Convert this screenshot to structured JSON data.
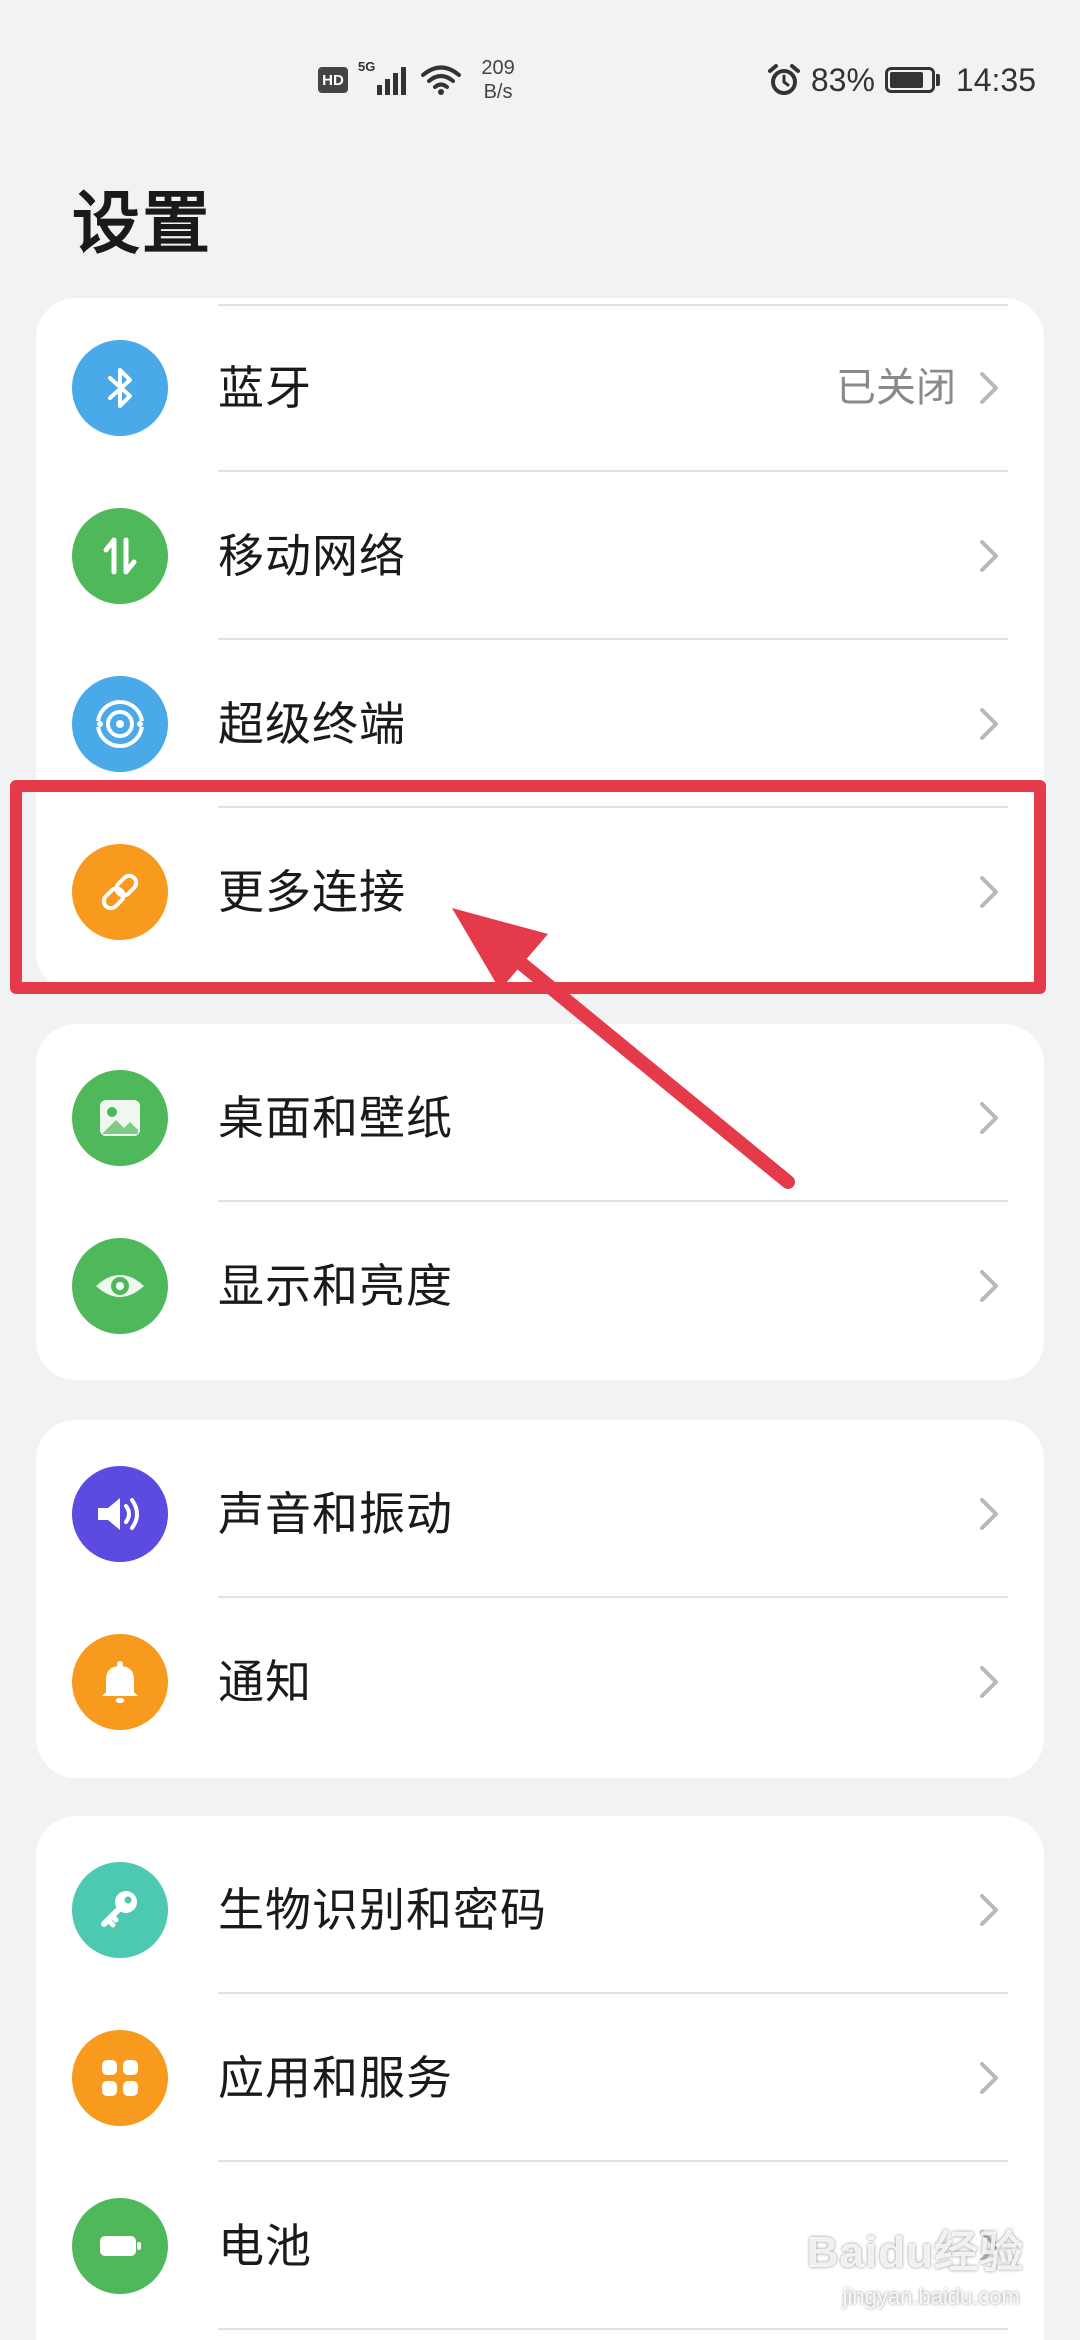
{
  "status_bar": {
    "hd": "HD",
    "network": "5G",
    "speed_value": "209",
    "speed_unit": "B/s",
    "battery": "83%",
    "battery_level": 0.83,
    "time": "14:35"
  },
  "title": "设置",
  "groups": [
    {
      "items": [
        {
          "label": "蓝牙",
          "value": "已关闭",
          "icon": "bluetooth-icon",
          "color": "#4aa9e8"
        },
        {
          "label": "移动网络",
          "value": "",
          "icon": "mobile-network-icon",
          "color": "#4fb85a"
        },
        {
          "label": "超级终端",
          "value": "",
          "icon": "super-device-icon",
          "color": "#4aa9e8"
        },
        {
          "label": "更多连接",
          "value": "",
          "icon": "link-icon",
          "color": "#f79a1d"
        }
      ]
    },
    {
      "items": [
        {
          "label": "桌面和壁纸",
          "icon": "wallpaper-icon",
          "color": "#4fb85a"
        },
        {
          "label": "显示和亮度",
          "icon": "eye-icon",
          "color": "#4fb85a"
        }
      ]
    },
    {
      "items": [
        {
          "label": "声音和振动",
          "icon": "speaker-icon",
          "color": "#5b4be0"
        },
        {
          "label": "通知",
          "icon": "bell-icon",
          "color": "#f79a1d"
        }
      ]
    },
    {
      "items": [
        {
          "label": "生物识别和密码",
          "icon": "key-icon",
          "color": "#4cc9b0"
        },
        {
          "label": "应用和服务",
          "icon": "apps-icon",
          "color": "#f79a1d"
        },
        {
          "label": "电池",
          "icon": "battery-icon",
          "color": "#4fb85a"
        }
      ]
    }
  ],
  "annotation": {
    "highlight_color": "#e53a4a"
  },
  "watermark": {
    "text": "Baidu经验",
    "sub": "jingyan.baidu.com"
  }
}
